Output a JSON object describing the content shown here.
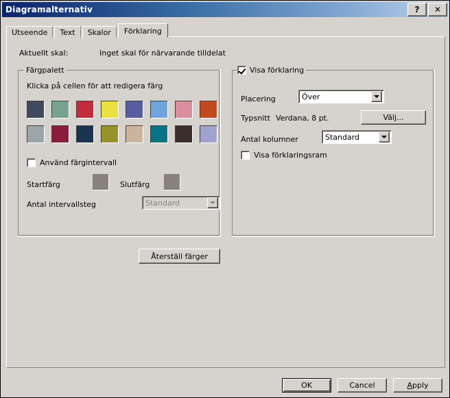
{
  "window": {
    "title": "Diagramalternativ",
    "help_button": "?",
    "close_button": "✕"
  },
  "tabs": [
    {
      "label": "Utseende",
      "active": false
    },
    {
      "label": "Text",
      "active": false
    },
    {
      "label": "Skalor",
      "active": false
    },
    {
      "label": "Förklaring",
      "active": true
    }
  ],
  "scale": {
    "label": "Aktuellt skal:",
    "value": "Inget skal för närvarande tilldelat"
  },
  "palette": {
    "group_title": "Färgpalett",
    "hint": "Klicka på cellen för att redigera färg",
    "colors_row1": [
      "#404a5e",
      "#78a290",
      "#c22d3e",
      "#ebe13f",
      "#575d9e",
      "#6fa5dd",
      "#d88e9c",
      "#c24a1c"
    ],
    "colors_row2": [
      "#9aa6a8",
      "#8a1c3c",
      "#1b3350",
      "#969429",
      "#ccb49c",
      "#067484",
      "#3c2e2a",
      "#a0a4cc"
    ],
    "interval_checkbox": {
      "label": "Använd färgintervall",
      "checked": false
    },
    "start_color_label": "Startfärg",
    "end_color_label": "Slutfärg",
    "steps_label": "Antal intervallsteg",
    "steps_value": "Standard",
    "reset_button": "Återställ färger"
  },
  "legend": {
    "group_checkbox": {
      "label": "Visa förklaring",
      "checked": true
    },
    "placement_label": "Placering",
    "placement_value": "Över",
    "font_label": "Typsnitt",
    "font_value": "Verdana, 8 pt.",
    "choose_button": "Välj...",
    "columns_label": "Antal kolumner",
    "columns_value": "Standard",
    "frame_checkbox": {
      "label": "Visa förklaringsram",
      "checked": false
    }
  },
  "footer": {
    "ok": "OK",
    "cancel": "Cancel",
    "apply_prefix": "A",
    "apply_rest": "pply"
  }
}
